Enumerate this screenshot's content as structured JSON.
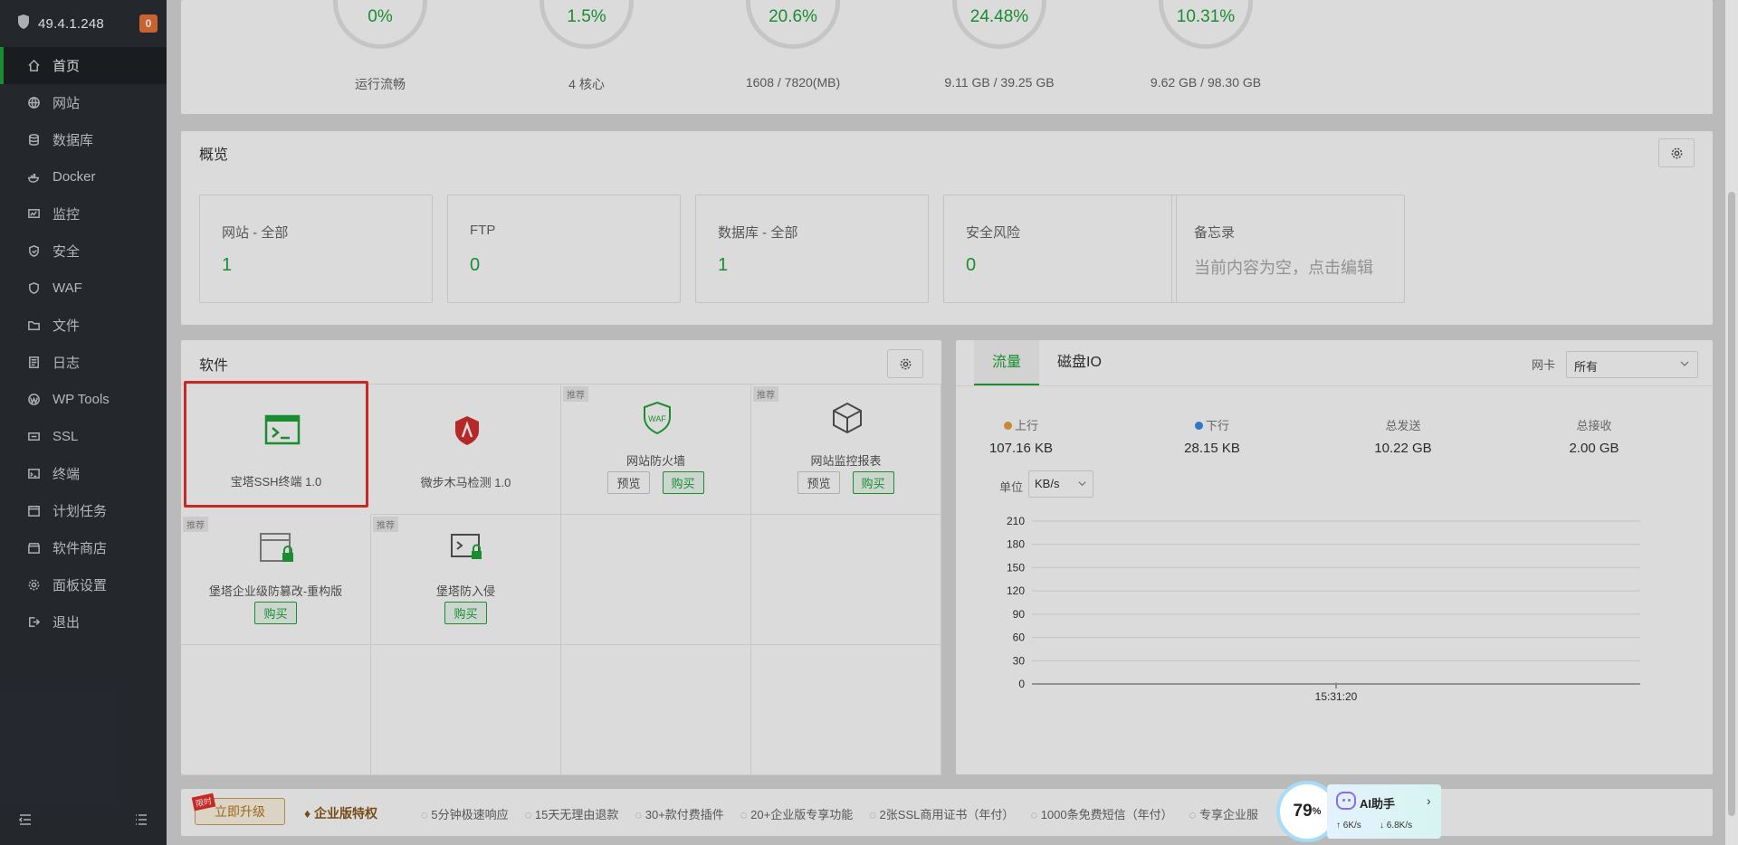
{
  "sidebar": {
    "ip": "49.4.1.248",
    "badge": "0",
    "items": [
      {
        "label": "首页",
        "icon": "home-icon"
      },
      {
        "label": "网站",
        "icon": "globe-icon"
      },
      {
        "label": "数据库",
        "icon": "database-icon"
      },
      {
        "label": "Docker",
        "icon": "docker-icon"
      },
      {
        "label": "监控",
        "icon": "monitor-icon"
      },
      {
        "label": "安全",
        "icon": "shield-icon"
      },
      {
        "label": "WAF",
        "icon": "waf-shield-icon"
      },
      {
        "label": "文件",
        "icon": "folder-icon"
      },
      {
        "label": "日志",
        "icon": "log-icon"
      },
      {
        "label": "WP Tools",
        "icon": "wordpress-icon"
      },
      {
        "label": "SSL",
        "icon": "ssl-icon"
      },
      {
        "label": "终端",
        "icon": "terminal-icon"
      },
      {
        "label": "计划任务",
        "icon": "calendar-icon"
      },
      {
        "label": "软件商店",
        "icon": "store-icon"
      },
      {
        "label": "面板设置",
        "icon": "gear-icon"
      },
      {
        "label": "退出",
        "icon": "logout-icon"
      }
    ]
  },
  "gauges": [
    {
      "value": "0%",
      "label": "运行流畅"
    },
    {
      "value": "1.5%",
      "label": "4 核心"
    },
    {
      "value": "20.6%",
      "label": "1608 / 7820(MB)"
    },
    {
      "value": "24.48%",
      "label": "9.11 GB / 39.25 GB"
    },
    {
      "value": "10.31%",
      "label": "9.62 GB / 98.30 GB"
    }
  ],
  "overview": {
    "title": "概览",
    "cards": [
      {
        "title": "网站 - 全部",
        "value": "1"
      },
      {
        "title": "FTP",
        "value": "0"
      },
      {
        "title": "数据库 - 全部",
        "value": "1"
      },
      {
        "title": "安全风险",
        "value": "0"
      }
    ],
    "memo": {
      "title": "备忘录",
      "placeholder": "当前内容为空，点击编辑"
    }
  },
  "software": {
    "title": "软件",
    "items": [
      {
        "name": "宝塔SSH终端 1.0",
        "tag": "",
        "buttons": []
      },
      {
        "name": "微步木马检测 1.0",
        "tag": "",
        "buttons": []
      },
      {
        "name": "网站防火墙",
        "tag": "推荐",
        "buttons": [
          "预览",
          "购买"
        ]
      },
      {
        "name": "网站监控报表",
        "tag": "推荐",
        "buttons": [
          "预览",
          "购买"
        ]
      },
      {
        "name": "堡塔企业级防篡改-重构版",
        "tag": "推荐",
        "buttons": [
          "购买"
        ]
      },
      {
        "name": "堡塔防入侵",
        "tag": "推荐",
        "buttons": [
          "购买"
        ]
      }
    ]
  },
  "traffic": {
    "tabs": [
      "流量",
      "磁盘IO"
    ],
    "nic_label": "网卡",
    "nic_value": "所有",
    "stats": [
      {
        "label": "上行",
        "value": "107.16 KB",
        "dot": "#e8a33a"
      },
      {
        "label": "下行",
        "value": "28.15 KB",
        "dot": "#3a8be8"
      },
      {
        "label": "总发送",
        "value": "10.22 GB",
        "dot": ""
      },
      {
        "label": "总接收",
        "value": "2.00 GB",
        "dot": ""
      }
    ],
    "unit_label": "单位",
    "unit_value": "KB/s"
  },
  "chart_data": {
    "type": "line",
    "x": [
      "15:31:20"
    ],
    "series": [
      {
        "values": [
          0
        ]
      }
    ],
    "yticks": [
      0,
      30,
      60,
      90,
      120,
      150,
      180,
      210
    ],
    "ylim": [
      0,
      210
    ],
    "grid": true
  },
  "bottom": {
    "upgrade_label": "立即升级",
    "ribbon": "限时",
    "vip_label": "企业版特权",
    "perks": [
      "5分钟极速响应",
      "15天无理由退款",
      "30+款付费插件",
      "20+企业版专享功能",
      "2张SSL商用证书（年付）",
      "1000条免费短信（年付）",
      "专享企业服"
    ]
  },
  "ai": {
    "percent": "79",
    "percent_unit": "%",
    "title": "AI助手",
    "up": "6K/s",
    "down": "6.8K/s"
  },
  "colors": {
    "accent": "#20a53a",
    "sidebar_bg": "#2b2f35",
    "highlight": "#e8302b"
  }
}
